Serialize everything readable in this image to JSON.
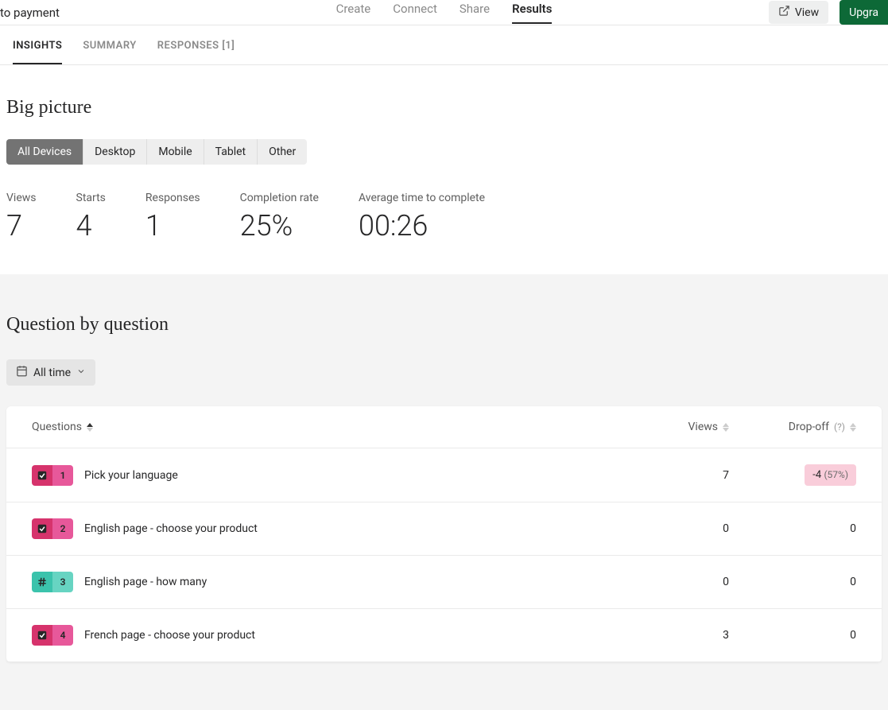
{
  "header": {
    "title_fragment": "to payment",
    "nav": [
      {
        "label": "Create",
        "active": false
      },
      {
        "label": "Connect",
        "active": false
      },
      {
        "label": "Share",
        "active": false
      },
      {
        "label": "Results",
        "active": true
      }
    ],
    "view_label": "View",
    "upgrade_label": "Upgra"
  },
  "subtabs": [
    {
      "label": "INSIGHTS",
      "active": true
    },
    {
      "label": "SUMMARY",
      "active": false
    },
    {
      "label": "RESPONSES [1]",
      "active": false
    }
  ],
  "big_picture": {
    "title": "Big picture",
    "device_tabs": [
      {
        "label": "All Devices",
        "active": true
      },
      {
        "label": "Desktop",
        "active": false
      },
      {
        "label": "Mobile",
        "active": false
      },
      {
        "label": "Tablet",
        "active": false
      },
      {
        "label": "Other",
        "active": false
      }
    ],
    "stats": {
      "views_label": "Views",
      "views_value": "7",
      "starts_label": "Starts",
      "starts_value": "4",
      "responses_label": "Responses",
      "responses_value": "1",
      "completion_label": "Completion rate",
      "completion_value": "25%",
      "avgtime_label": "Average time to complete",
      "avgtime_value": "00:26"
    }
  },
  "question_section": {
    "title": "Question by question",
    "filter_label": "All time",
    "headers": {
      "questions": "Questions",
      "views": "Views",
      "dropoff": "Drop-off",
      "help": "(?)"
    },
    "rows": [
      {
        "num": "1",
        "icon": "check",
        "color": "pink",
        "title": "Pick your language",
        "views": "7",
        "dropoff": "-4",
        "dropoff_pct": "(57%)",
        "has_dropoff_pill": true
      },
      {
        "num": "2",
        "icon": "check",
        "color": "pink",
        "title": "English page - choose your product",
        "views": "0",
        "dropoff": "0",
        "has_dropoff_pill": false
      },
      {
        "num": "3",
        "icon": "hash",
        "color": "teal",
        "title": "English page - how many",
        "views": "0",
        "dropoff": "0",
        "has_dropoff_pill": false
      },
      {
        "num": "4",
        "icon": "check",
        "color": "pink",
        "title": "French page - choose your product",
        "views": "3",
        "dropoff": "0",
        "has_dropoff_pill": false
      }
    ]
  }
}
